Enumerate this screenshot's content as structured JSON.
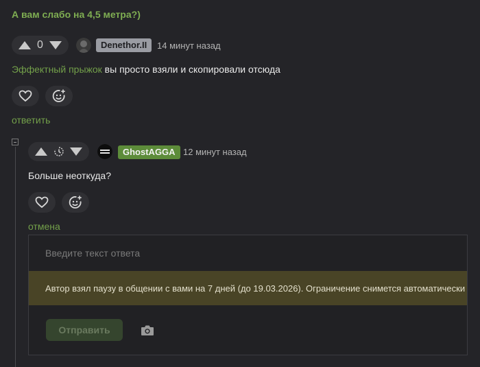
{
  "top_comment_tail": "А вам слабо на 4,5 метра?)",
  "comment1": {
    "vote_count": "0",
    "author": "Denethor.II",
    "author_badge_color": "#9a9ca3",
    "time": "14 минут назад",
    "link_text": "Эффектный прыжок",
    "text": " вы просто взяли и скопировали отсюда",
    "reply_link": "ответить"
  },
  "comment2": {
    "author": "GhostAGGA",
    "author_badge_color": "#5d8c3a",
    "time": "12 минут назад",
    "text": "Больше неоткуда?",
    "cancel_link": "отмена"
  },
  "reply_form": {
    "placeholder": "Введите текст ответа",
    "notice": "Автор взял паузу в общении с вами на 7 дней (до 19.03.2026). Ограничение снимется автоматически",
    "send_label": "Отправить"
  },
  "icons": {
    "upvote": "triangle-up-icon",
    "downvote": "triangle-down-icon",
    "timer": "timer-icon",
    "heart": "heart-icon",
    "emoji_add": "emoji-add-icon",
    "camera": "camera-icon",
    "collapse": "collapse-icon"
  },
  "colors": {
    "background": "#242428",
    "accent_green": "#73a04a",
    "notice_bg": "#494426"
  }
}
